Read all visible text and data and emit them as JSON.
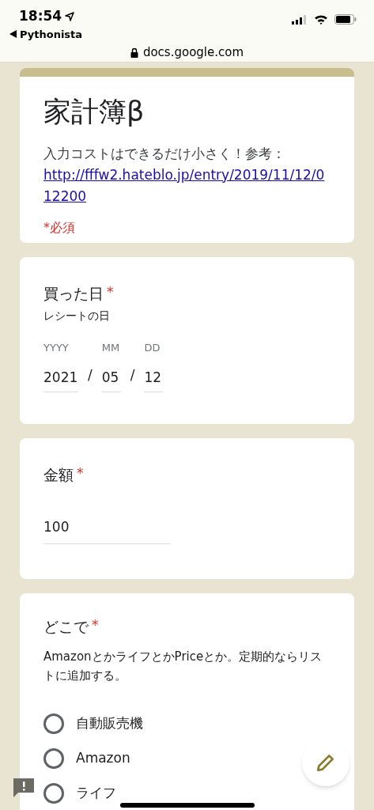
{
  "status_bar": {
    "time": "18:54",
    "back_app": "Pythonista"
  },
  "address_bar": {
    "url": "docs.google.com"
  },
  "form_header": {
    "title": "家計簿β",
    "description": "入力コストはできるだけ小さく！参考：",
    "link": "http://fffw2.hateblo.jp/entry/2019/11/12/012200",
    "required_note": "*必須"
  },
  "questions": [
    {
      "kind": "date",
      "title": "買った日",
      "required_mark": "*",
      "help": "レシートの日",
      "parts": [
        {
          "label": "YYYY",
          "value": "2021"
        },
        {
          "label": "MM",
          "value": "05"
        },
        {
          "label": "DD",
          "value": "12"
        }
      ],
      "separator": "/"
    },
    {
      "kind": "text",
      "title": "金額",
      "required_mark": "*",
      "value": "100"
    },
    {
      "kind": "radio",
      "title": "どこで",
      "required_mark": "*",
      "help": "AmazonとかライフとかPriceとか。定期的ならリストに追加する。",
      "options": [
        {
          "label": "自動販売機",
          "selected": false
        },
        {
          "label": "Amazon",
          "selected": false
        },
        {
          "label": "ライフ",
          "selected": false
        }
      ]
    }
  ]
}
